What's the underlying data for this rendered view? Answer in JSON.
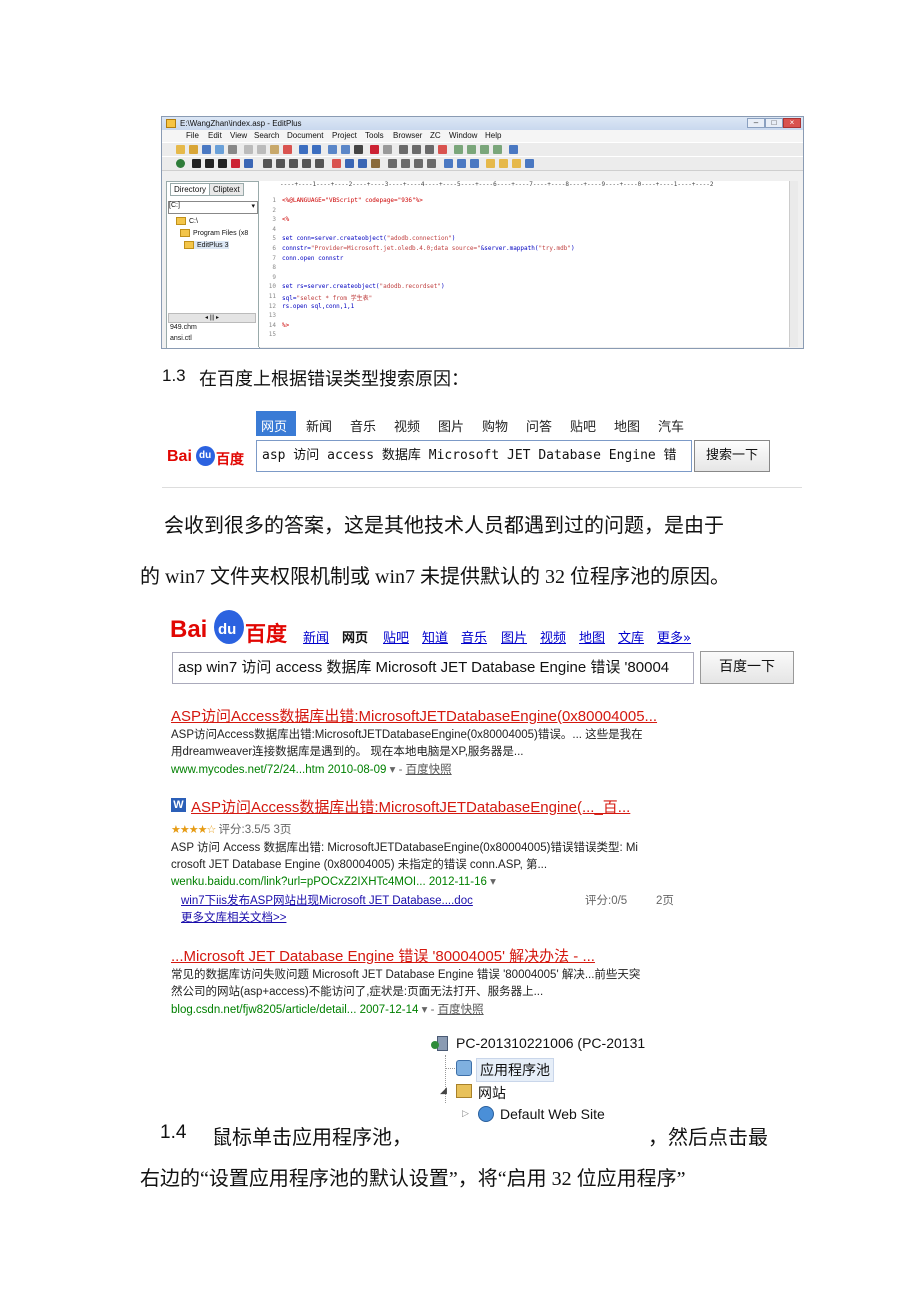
{
  "editplus": {
    "title": "E:\\WangZhan\\index.asp - EditPlus",
    "menu": [
      "File",
      "Edit",
      "View",
      "Search",
      "Document",
      "Project",
      "Tools",
      "Browser",
      "ZC",
      "Window",
      "Help"
    ],
    "tabs": [
      "Directory",
      "Cliptext"
    ],
    "drive": "[C:]",
    "tree": [
      "C:\\",
      "Program Files (x8",
      "EditPlus 3"
    ],
    "files": [
      "949.chm",
      "ansi.ctl"
    ],
    "ruler": "----+----1----+----2----+----3----+----4----+----5----+----6----+----7----+----8----+----9----+----0----+----1----+----2",
    "lines": [
      {
        "n": "1",
        "text": "<%@LANGUAGE=\"VBScript\" codepage=\"936\"%>"
      },
      {
        "n": "2",
        "text": ""
      },
      {
        "n": "3",
        "text": "<%"
      },
      {
        "n": "4",
        "text": ""
      },
      {
        "n": "5",
        "text": "set conn=server.createobject(\"adodb.connection\")"
      },
      {
        "n": "6",
        "text": "connstr=\"Provider=Microsoft.jet.oledb.4.0;data source=\"&server.mappath(\"try.mdb\")"
      },
      {
        "n": "7",
        "text": "conn.open connstr"
      },
      {
        "n": "8",
        "text": ""
      },
      {
        "n": "9",
        "text": ""
      },
      {
        "n": "10",
        "text": "set rs=server.createobject(\"adodb.recordset\")"
      },
      {
        "n": "11",
        "text": "sql=\"select * from 学生表\""
      },
      {
        "n": "12",
        "text": "rs.open sql,conn,1,1"
      },
      {
        "n": "13",
        "text": ""
      },
      {
        "n": "14",
        "text": "%>"
      },
      {
        "n": "15",
        "text": ""
      }
    ]
  },
  "section_1_3": {
    "number": "1.3",
    "text": "在百度上根据错误类型搜索原因："
  },
  "baidu_box1": {
    "tabs": [
      "网页",
      "新闻",
      "音乐",
      "视频",
      "图片",
      "购物",
      "问答",
      "贴吧",
      "地图",
      "汽车"
    ],
    "logo_bai": "Bai",
    "logo_du": "du",
    "logo_cn": "百度",
    "query": "asp 访问 access 数据库  Microsoft JET Database Engine 错",
    "button": "搜索一下"
  },
  "para1": {
    "line1": "会收到很多的答案，这是其他技术人员都遇到过的问题，是由于",
    "line2": "的 win7 文件夹权限机制或 win7 未提供默认的 32 位程序池的原因。"
  },
  "baidu_results": {
    "logo_bai": "Bai",
    "logo_du": "du",
    "logo_cn": "百度",
    "nav": [
      "新闻",
      "网页",
      "贴吧",
      "知道",
      "音乐",
      "图片",
      "视频",
      "地图",
      "文库",
      "更多»"
    ],
    "query": "asp win7 访问  access 数据库  Microsoft JET Database Engine 错误  '80004",
    "button": "百度一下",
    "results": [
      {
        "title": "ASP访问Access数据库出错:MicrosoftJETDatabaseEngine(0x80004005...",
        "desc1": "ASP访问Access数据库出错:MicrosoftJETDatabaseEngine(0x80004005)错误。... 这些是我在",
        "desc2": "用dreamweaver连接数据库是遇到的。 现在本地电脑是XP,服务器是...",
        "url": "www.mycodes.net/72/24...htm 2010-08-09",
        "kuai": "百度快照"
      },
      {
        "title": "ASP访问Access数据库出错:MicrosoftJETDatabaseEngine(..._百...",
        "stars": "★★★★☆",
        "rating": "评分:3.5/5 3页",
        "desc1": "ASP 访问 Access 数据库出错: MicrosoftJETDatabaseEngine(0x80004005)错误错误类型: Mi",
        "desc2": "crosoft JET Database Engine (0x80004005) 未指定的错误  conn.ASP, 第...",
        "url": "wenku.baidu.com/link?url=pPOCxZ2IXHTc4MOI... 2012-11-16",
        "sub_link": "win7下iis发布ASP网站出现Microsoft  JET  Database....doc",
        "sub_rating": "评分:0/5",
        "sub_pages": "2页",
        "more": "更多文库相关文档>>"
      },
      {
        "title": "...Microsoft JET Database Engine 错误  '80004005' 解决办法 - ...",
        "desc1": "常见的数据库访问失败问题  Microsoft JET Database Engine 错误  '80004005' 解决...前些天突",
        "desc2": "然公司的网站(asp+access)不能访问了,症状是:页面无法打开、服务器上...",
        "url": "blog.csdn.net/fjw8205/article/detail... 2007-12-14",
        "kuai": "百度快照"
      }
    ]
  },
  "iis_tree": {
    "server": "PC-201310221006 (PC-20131",
    "app_pools": "应用程序池",
    "sites": "网站",
    "default_site": "Default Web Site"
  },
  "section_1_4": {
    "number": "1.4",
    "text_before": "鼠标单击应用程序池，",
    "text_after": "，然后点击最",
    "line2": "右边的“设置应用程序池的默认设置”，将“启用 32 位应用程序”"
  }
}
